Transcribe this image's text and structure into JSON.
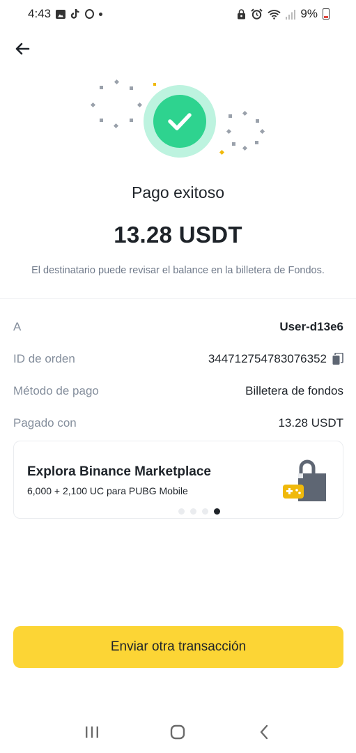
{
  "status_bar": {
    "time": "4:43",
    "battery": "9%",
    "icons_left": [
      "image-icon",
      "tiktok-icon",
      "opera-icon",
      "dot-icon"
    ],
    "icons_right": [
      "lock-icon",
      "alarm-icon",
      "wifi-icon",
      "signal-icon",
      "battery-icon"
    ]
  },
  "header": {
    "back_icon": "arrow-left-icon"
  },
  "result": {
    "title": "Pago exitoso",
    "amount": "13.28 USDT",
    "note": "El destinatario puede revisar el balance en la billetera de Fondos."
  },
  "details": [
    {
      "label": "A",
      "value": "User-d13e6"
    },
    {
      "label": "ID de orden",
      "value": "344712754783076352"
    },
    {
      "label": "Método de pago",
      "value": "Billetera de fondos"
    },
    {
      "label": "Pagado con",
      "value": "13.28 USDT"
    }
  ],
  "promo": {
    "title": "Explora Binance Marketplace",
    "subtitle": "6,000 + 2,100 UC para PUBG Mobile",
    "carousel_count": 4,
    "active_index": 3
  },
  "actions": {
    "primary_label": "Enviar otra transacción"
  },
  "colors": {
    "accent_yellow": "#fcd535",
    "success_green": "#2ed38f",
    "success_ring": "#bdf3df",
    "text_primary": "#1e2329",
    "text_secondary": "#848e9c"
  },
  "nav": {
    "icons": [
      "recent-apps-icon",
      "home-icon",
      "back-icon"
    ]
  }
}
